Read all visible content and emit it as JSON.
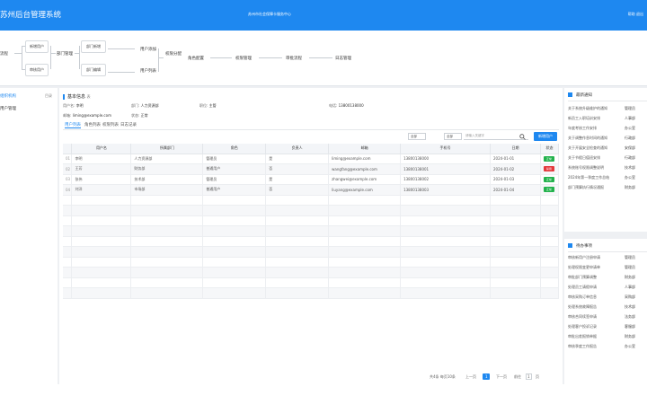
{
  "app": {
    "title": "苏州后台管理系统",
    "center_text": "苏州市社会保障卡服务中心",
    "right_text": "帮助 退出"
  },
  "flow": {
    "labels": [
      "流程",
      "新增用户",
      "审核用户",
      "部门管理",
      "部门新增",
      "部门编辑",
      "用户添加",
      "用户列表",
      "权限分配",
      "角色配置",
      "权限管理",
      "审批流程",
      "日志管理"
    ]
  },
  "leftnav": {
    "header": "组织机构",
    "header_right": "目录",
    "item": "用户管理"
  },
  "main": {
    "section_title": "基本信息",
    "section_sub": "表",
    "info": [
      {
        "k": "用户名:",
        "v": "李明"
      },
      {
        "k": "部门:",
        "v": "人力资源部"
      },
      {
        "k": "职位:",
        "v": "主管"
      },
      {
        "k": "电话:",
        "v": "13800138000"
      }
    ],
    "info2": [
      {
        "k": "邮箱:",
        "v": "liming@example.com"
      },
      {
        "k": "状态:",
        "v": "正常"
      }
    ],
    "tabs": [
      "用户列表",
      "角色列表",
      "权限列表",
      "日志记录"
    ],
    "filters": {
      "sel1": "全部",
      "sel2": "全部",
      "search_placeholder": "请输入关键字"
    },
    "add_label": "新增用户",
    "columns": [
      "用户名",
      "所属部门",
      "角色",
      "负责人",
      "邮箱",
      "手机号",
      "日期",
      "状态"
    ],
    "rows": [
      {
        "c": [
          "李明",
          "人力资源部",
          "管理员",
          "是",
          "liming@example.com",
          "13800138000",
          "2024-01-01"
        ],
        "status": "正常",
        "color": "#22b24c"
      },
      {
        "c": [
          "王芳",
          "财务部",
          "普通用户",
          "否",
          "wangfang@example.com",
          "13800138001",
          "2024-01-02"
        ],
        "status": "禁用",
        "color": "#e4393c"
      },
      {
        "c": [
          "张伟",
          "技术部",
          "管理员",
          "是",
          "zhangwei@example.com",
          "13800138002",
          "2024-01-03"
        ],
        "status": "正常",
        "color": "#22b24c"
      },
      {
        "c": [
          "刘洋",
          "市场部",
          "普通用户",
          "否",
          "liuyang@example.com",
          "13800138003",
          "2024-01-04"
        ],
        "status": "正常",
        "color": "#22b24c"
      }
    ],
    "pagination": {
      "total": "共4条 每页10条",
      "prev": "上一页",
      "page": "1",
      "next": "下一页",
      "goto": "前往",
      "goto_page": "1",
      "page_unit": "页"
    }
  },
  "panel1": {
    "title": "最新通知",
    "items": [
      {
        "t": "关于系统升级维护的通知",
        "n": "管理员"
      },
      {
        "t": "新员工入职培训安排",
        "n": "人事部"
      },
      {
        "t": "年度考核工作安排",
        "n": "办公室"
      },
      {
        "t": "关于调整作息时间的通知",
        "n": "行政部"
      },
      {
        "t": "关于开展安全检查的通知",
        "n": "安保部"
      },
      {
        "t": "关于节假日值班安排",
        "n": "行政部"
      },
      {
        "t": "系统账号权限调整说明",
        "n": "技术部"
      },
      {
        "t": "2024年第一季度工作总结",
        "n": "办公室"
      },
      {
        "t": "部门预算执行情况通报",
        "n": "财务部"
      }
    ]
  },
  "panel2": {
    "title": "待办事项",
    "items": [
      {
        "t": "审核新用户注册申请",
        "n": "管理员"
      },
      {
        "t": "处理权限变更申请单",
        "n": "管理员"
      },
      {
        "t": "审批部门预算调整",
        "n": "财务部"
      },
      {
        "t": "处理员工请假申请",
        "n": "人事部"
      },
      {
        "t": "审核采购订单信息",
        "n": "采购部"
      },
      {
        "t": "处理系统故障报告",
        "n": "技术部"
      },
      {
        "t": "审核合同续签申请",
        "n": "法务部"
      },
      {
        "t": "处理客户投诉记录",
        "n": "客服部"
      },
      {
        "t": "审批出差报销单据",
        "n": "财务部"
      },
      {
        "t": "审核季度工作报告",
        "n": "办公室"
      }
    ]
  }
}
